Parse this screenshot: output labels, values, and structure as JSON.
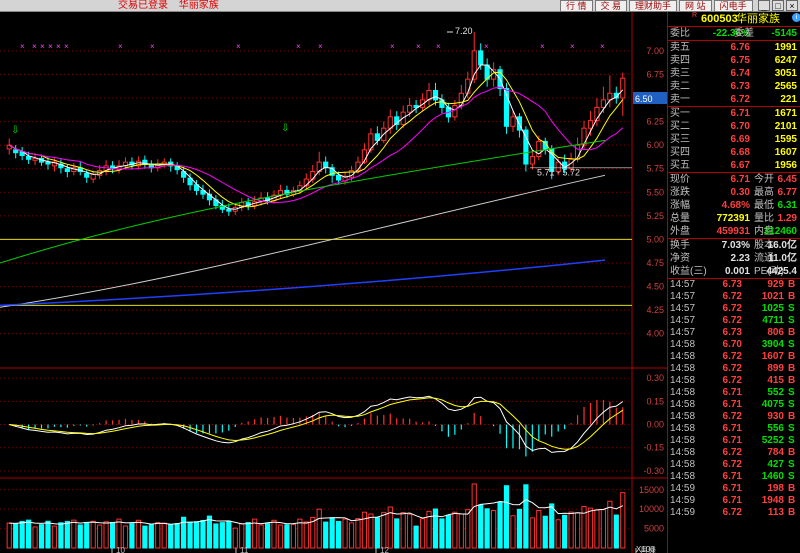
{
  "topbar": {
    "status": "交易已登录",
    "stock_link": "华丽家族",
    "buttons": [
      "行 情",
      "交 易",
      "理财助手",
      "网 站",
      "闪电手"
    ],
    "win": [
      "_",
      "□",
      "×"
    ]
  },
  "chart_data": [
    {
      "type": "candlestick",
      "title": "",
      "ylim": [
        3.7,
        7.2
      ],
      "y_ticks": [
        "7.00",
        "6.75",
        "6.50",
        "6.25",
        "6.00",
        "5.75",
        "5.50",
        "5.25",
        "5.00",
        "4.75",
        "4.50",
        "4.25",
        "4.00"
      ],
      "current_price_tag": "6.50",
      "annotations": [
        "7.20",
        "5.71 - 5.72"
      ],
      "hlines": [
        5.0,
        4.3
      ],
      "candles": [
        [
          5.96,
          6.0,
          6.07,
          5.9
        ],
        [
          5.95,
          5.92,
          6.0,
          5.86
        ],
        [
          5.93,
          5.89,
          5.98,
          5.84
        ],
        [
          5.88,
          5.85,
          5.93,
          5.8
        ],
        [
          5.84,
          5.86,
          5.91,
          5.79
        ],
        [
          5.86,
          5.82,
          5.9,
          5.78
        ],
        [
          5.82,
          5.8,
          5.87,
          5.74
        ],
        [
          5.78,
          5.82,
          5.86,
          5.72
        ],
        [
          5.8,
          5.76,
          5.85,
          5.7
        ],
        [
          5.75,
          5.72,
          5.8,
          5.66
        ],
        [
          5.72,
          5.76,
          5.81,
          5.68
        ],
        [
          5.76,
          5.72,
          5.82,
          5.68
        ],
        [
          5.7,
          5.66,
          5.74,
          5.6
        ],
        [
          5.64,
          5.69,
          5.73,
          5.6
        ],
        [
          5.68,
          5.73,
          5.79,
          5.64
        ],
        [
          5.72,
          5.78,
          5.84,
          5.68
        ],
        [
          5.78,
          5.75,
          5.83,
          5.7
        ],
        [
          5.74,
          5.78,
          5.84,
          5.7
        ],
        [
          5.78,
          5.82,
          5.87,
          5.74
        ],
        [
          5.82,
          5.79,
          5.87,
          5.74
        ],
        [
          5.78,
          5.83,
          5.88,
          5.74
        ],
        [
          5.84,
          5.8,
          5.89,
          5.75
        ],
        [
          5.8,
          5.76,
          5.84,
          5.71
        ],
        [
          5.76,
          5.8,
          5.85,
          5.72
        ],
        [
          5.8,
          5.82,
          5.86,
          5.76
        ],
        [
          5.82,
          5.78,
          5.86,
          5.72
        ],
        [
          5.78,
          5.74,
          5.82,
          5.69
        ],
        [
          5.72,
          5.66,
          5.77,
          5.6
        ],
        [
          5.65,
          5.58,
          5.7,
          5.52
        ],
        [
          5.58,
          5.52,
          5.63,
          5.47
        ],
        [
          5.52,
          5.48,
          5.58,
          5.43
        ],
        [
          5.48,
          5.42,
          5.53,
          5.36
        ],
        [
          5.42,
          5.36,
          5.47,
          5.32
        ],
        [
          5.36,
          5.32,
          5.42,
          5.28
        ],
        [
          5.32,
          5.3,
          5.38,
          5.25
        ],
        [
          5.3,
          5.34,
          5.38,
          5.26
        ],
        [
          5.34,
          5.39,
          5.44,
          5.3
        ],
        [
          5.39,
          5.36,
          5.44,
          5.31
        ],
        [
          5.36,
          5.4,
          5.46,
          5.32
        ],
        [
          5.4,
          5.44,
          5.5,
          5.36
        ],
        [
          5.44,
          5.41,
          5.5,
          5.37
        ],
        [
          5.41,
          5.47,
          5.52,
          5.38
        ],
        [
          5.47,
          5.52,
          5.58,
          5.43
        ],
        [
          5.52,
          5.48,
          5.57,
          5.44
        ],
        [
          5.48,
          5.52,
          5.56,
          5.45
        ],
        [
          5.52,
          5.57,
          5.62,
          5.48
        ],
        [
          5.57,
          5.64,
          5.7,
          5.53
        ],
        [
          5.64,
          5.72,
          5.79,
          5.6
        ],
        [
          5.72,
          5.82,
          5.93,
          5.68
        ],
        [
          5.82,
          5.76,
          5.88,
          5.7
        ],
        [
          5.76,
          5.68,
          5.8,
          5.6
        ],
        [
          5.68,
          5.63,
          5.72,
          5.58
        ],
        [
          5.62,
          5.67,
          5.72,
          5.58
        ],
        [
          5.66,
          5.73,
          5.78,
          5.62
        ],
        [
          5.73,
          5.82,
          5.88,
          5.7
        ],
        [
          5.82,
          5.95,
          6.02,
          5.8
        ],
        [
          5.95,
          6.12,
          6.18,
          5.92
        ],
        [
          6.12,
          6.05,
          6.2,
          6.0
        ],
        [
          6.05,
          6.18,
          6.25,
          6.02
        ],
        [
          6.18,
          6.3,
          6.38,
          6.12
        ],
        [
          6.3,
          6.22,
          6.36,
          6.16
        ],
        [
          6.22,
          6.35,
          6.42,
          6.18
        ],
        [
          6.35,
          6.42,
          6.5,
          6.3
        ],
        [
          6.42,
          6.4,
          6.48,
          6.34
        ],
        [
          6.4,
          6.48,
          6.55,
          6.36
        ],
        [
          6.48,
          6.58,
          6.66,
          6.42
        ],
        [
          6.58,
          6.48,
          6.66,
          6.42
        ],
        [
          6.48,
          6.4,
          6.54,
          6.34
        ],
        [
          6.4,
          6.3,
          6.45,
          6.24
        ],
        [
          6.3,
          6.42,
          6.48,
          6.26
        ],
        [
          6.42,
          6.55,
          6.64,
          6.38
        ],
        [
          6.55,
          6.7,
          6.78,
          6.5
        ],
        [
          6.7,
          7.0,
          7.2,
          6.66
        ],
        [
          7.0,
          6.85,
          7.08,
          6.8
        ],
        [
          6.85,
          6.7,
          6.92,
          6.62
        ],
        [
          6.7,
          6.8,
          6.88,
          6.62
        ],
        [
          6.8,
          6.6,
          6.84,
          6.52
        ],
        [
          6.6,
          6.2,
          6.66,
          6.12
        ],
        [
          6.2,
          6.3,
          6.36,
          6.14
        ],
        [
          6.3,
          6.16,
          6.34,
          6.08
        ],
        [
          6.16,
          5.8,
          6.2,
          5.72
        ],
        [
          5.8,
          5.88,
          5.95,
          5.74
        ],
        [
          5.88,
          6.04,
          6.1,
          5.84
        ],
        [
          6.04,
          5.96,
          6.08,
          5.9
        ],
        [
          5.96,
          5.72,
          6.0,
          5.64
        ],
        [
          5.72,
          5.82,
          5.86,
          5.68
        ],
        [
          5.82,
          5.75,
          5.9,
          5.7
        ],
        [
          5.75,
          5.85,
          5.92,
          5.71
        ],
        [
          5.85,
          6.0,
          6.08,
          5.82
        ],
        [
          6.0,
          6.18,
          6.26,
          5.96
        ],
        [
          6.18,
          6.26,
          6.36,
          6.1
        ],
        [
          6.26,
          6.4,
          6.5,
          6.2
        ],
        [
          6.4,
          6.48,
          6.62,
          6.34
        ],
        [
          6.48,
          6.55,
          6.74,
          6.4
        ],
        [
          6.55,
          6.5,
          6.62,
          6.44
        ],
        [
          6.5,
          6.71,
          6.77,
          6.31
        ]
      ]
    },
    {
      "type": "line",
      "title": "",
      "ylim": [
        -0.32,
        0.34
      ],
      "y_ticks": [
        "0.30",
        "0.15",
        "0.00",
        "-0.15",
        "-0.30"
      ]
    },
    {
      "type": "bar",
      "title": "",
      "ylim": [
        0,
        17000
      ],
      "y_ticks": [
        "15000",
        "10000",
        "5000"
      ],
      "unit_label": "X100",
      "x_labels": [
        "10",
        "11",
        "12",
        "月线"
      ]
    }
  ],
  "panel": {
    "code": "600503",
    "name": "华丽家族",
    "rmark": "R",
    "wb": {
      "l1": "委比",
      "v1": "-22.36%",
      "l2": "委差",
      "v2": "-5145"
    },
    "asks": [
      {
        "l": "卖五",
        "p": "6.76",
        "v": "1991"
      },
      {
        "l": "卖四",
        "p": "6.75",
        "v": "6247"
      },
      {
        "l": "卖三",
        "p": "6.74",
        "v": "3051"
      },
      {
        "l": "卖二",
        "p": "6.73",
        "v": "2565"
      },
      {
        "l": "卖一",
        "p": "6.72",
        "v": "221"
      }
    ],
    "bids": [
      {
        "l": "买一",
        "p": "6.71",
        "v": "1671"
      },
      {
        "l": "买二",
        "p": "6.70",
        "v": "2101"
      },
      {
        "l": "买三",
        "p": "6.69",
        "v": "1595"
      },
      {
        "l": "买四",
        "p": "6.68",
        "v": "1607"
      },
      {
        "l": "买五",
        "p": "6.67",
        "v": "1956"
      }
    ],
    "stats": [
      {
        "l1": "现价",
        "v1": "6.71",
        "c1": "red",
        "l2": "今开",
        "v2": "6.45",
        "c2": "red"
      },
      {
        "l1": "涨跌",
        "v1": "0.30",
        "c1": "red",
        "l2": "最高",
        "v2": "6.77",
        "c2": "red"
      },
      {
        "l1": "涨幅",
        "v1": "4.68%",
        "c1": "red",
        "l2": "最低",
        "v2": "6.31",
        "c2": "green"
      },
      {
        "l1": "总量",
        "v1": "772391",
        "c1": "yel",
        "l2": "量比",
        "v2": "1.29",
        "c2": "red"
      },
      {
        "l1": "外盘",
        "v1": "459931",
        "c1": "red",
        "l2": "内盘",
        "v2": "312460",
        "c2": "green"
      }
    ],
    "stats2": [
      {
        "l1": "换手",
        "v1": "7.03%",
        "l2": "股本",
        "v2": "16.0亿"
      },
      {
        "l1": "净资",
        "v1": "2.23",
        "l2": "流通",
        "v2": "11.0亿"
      },
      {
        "l1": "收益(三)",
        "v1": "0.001",
        "l2": "PE(动)",
        "v2": "4425.4"
      }
    ],
    "ticks": [
      {
        "t": "14:57",
        "p": "6.73",
        "v": "929",
        "s": "B"
      },
      {
        "t": "14:57",
        "p": "6.72",
        "v": "1021",
        "s": "B"
      },
      {
        "t": "14:57",
        "p": "6.72",
        "v": "1025",
        "s": "S"
      },
      {
        "t": "14:57",
        "p": "6.72",
        "v": "4711",
        "s": "S"
      },
      {
        "t": "14:57",
        "p": "6.73",
        "v": "806",
        "s": "B"
      },
      {
        "t": "14:58",
        "p": "6.70",
        "v": "3904",
        "s": "S"
      },
      {
        "t": "14:58",
        "p": "6.72",
        "v": "1607",
        "s": "B"
      },
      {
        "t": "14:58",
        "p": "6.72",
        "v": "899",
        "s": "B"
      },
      {
        "t": "14:58",
        "p": "6.72",
        "v": "415",
        "s": "B"
      },
      {
        "t": "14:58",
        "p": "6.71",
        "v": "552",
        "s": "S"
      },
      {
        "t": "14:58",
        "p": "6.71",
        "v": "4075",
        "s": "S"
      },
      {
        "t": "14:58",
        "p": "6.72",
        "v": "930",
        "s": "B"
      },
      {
        "t": "14:58",
        "p": "6.71",
        "v": "556",
        "s": "S"
      },
      {
        "t": "14:58",
        "p": "6.71",
        "v": "5252",
        "s": "S"
      },
      {
        "t": "14:58",
        "p": "6.72",
        "v": "784",
        "s": "B"
      },
      {
        "t": "14:58",
        "p": "6.72",
        "v": "427",
        "s": "S"
      },
      {
        "t": "14:58",
        "p": "6.71",
        "v": "1460",
        "s": "S"
      },
      {
        "t": "14:59",
        "p": "6.71",
        "v": "198",
        "s": "B"
      },
      {
        "t": "14:59",
        "p": "6.71",
        "v": "1948",
        "s": "B"
      },
      {
        "t": "14:59",
        "p": "6.72",
        "v": "113",
        "s": "B"
      }
    ]
  }
}
